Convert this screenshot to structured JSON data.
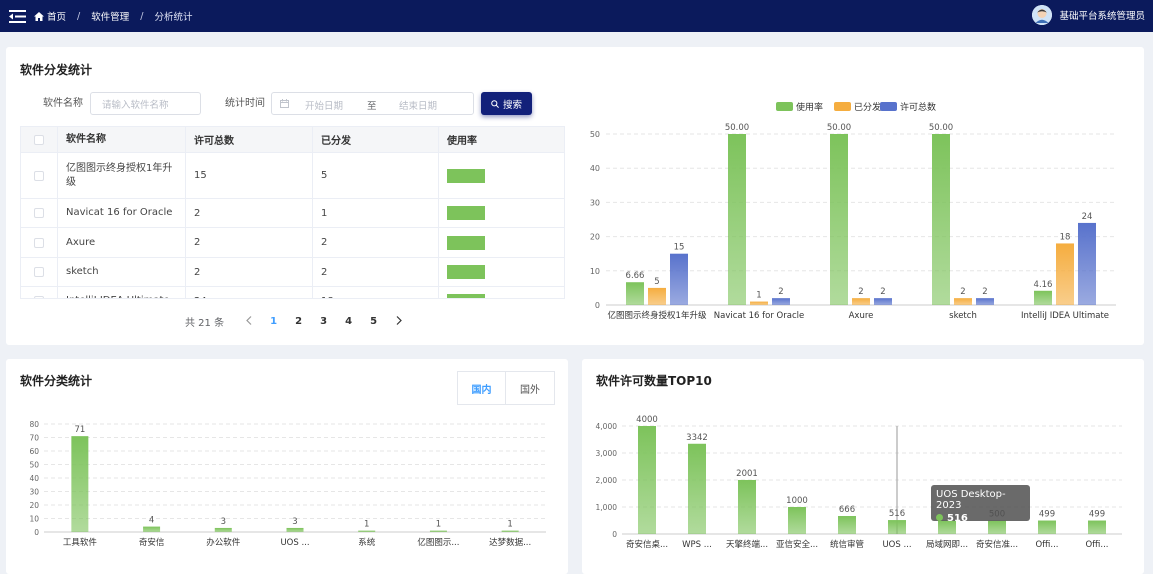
{
  "topbar": {
    "breadcrumbs": [
      "首页",
      "软件管理",
      "分析统计"
    ],
    "separator": "/",
    "user_name": "基础平台系统管理员"
  },
  "dist": {
    "title": "软件分发统计",
    "filters": {
      "name_label": "软件名称",
      "name_placeholder": "请输入软件名称",
      "time_label": "统计时间",
      "start_placeholder": "开始日期",
      "range_sep": "至",
      "end_placeholder": "结束日期",
      "search_label": "搜索"
    },
    "table": {
      "headers": [
        "软件名称",
        "许可总数",
        "已分发",
        "使用率"
      ],
      "rows": [
        {
          "name": "亿图图示终身授权1年升级",
          "total": "15",
          "dist": "5",
          "rate": 0.3333
        },
        {
          "name": "Navicat 16 for Oracle",
          "total": "2",
          "dist": "1",
          "rate": 0.5
        },
        {
          "name": "Axure",
          "total": "2",
          "dist": "2",
          "rate": 1
        },
        {
          "name": "sketch",
          "total": "2",
          "dist": "2",
          "rate": 1
        },
        {
          "name": "IntelliJ IDEA Ultimate",
          "total": "24",
          "dist": "18",
          "rate": 0.75
        }
      ]
    },
    "pagination": {
      "total": "共 21 条",
      "pages": [
        "1",
        "2",
        "3",
        "4",
        "5"
      ],
      "current": "1"
    }
  },
  "chart_data": [
    {
      "type": "bar",
      "legend": [
        "使用率",
        "已分发",
        "许可总数"
      ],
      "legend_position": "top",
      "categories": [
        "亿图图示终身授权1年升级",
        "Navicat 16 for Oracle",
        "Axure",
        "sketch",
        "IntelliJ IDEA Ultimate"
      ],
      "series": [
        {
          "name": "使用率",
          "values": [
            6.66,
            50.0,
            50.0,
            50.0,
            4.16
          ],
          "labels": [
            "6.66",
            "50.00",
            "50.00",
            "50.00",
            "4.16"
          ],
          "color": "#7dc35b"
        },
        {
          "name": "已分发",
          "values": [
            5,
            1,
            2,
            2,
            18
          ],
          "labels": [
            "5",
            "1",
            "2",
            "2",
            "18"
          ],
          "color": "#f5ad3f"
        },
        {
          "name": "许可总数",
          "values": [
            15,
            2,
            2,
            2,
            24
          ],
          "labels": [
            "15",
            "2",
            "2",
            "2",
            "24"
          ],
          "color": "#5872cc"
        }
      ],
      "ylim": [
        0,
        50
      ],
      "yticks": [
        "0",
        "10",
        "20",
        "30",
        "40",
        "50"
      ],
      "grid": true
    },
    {
      "type": "bar",
      "title": "软件分类统计",
      "categories": [
        "工具软件",
        "奇安信",
        "办公软件",
        "UOS ...",
        "系统",
        "亿图图示...",
        "达梦数据..."
      ],
      "values": [
        71,
        4,
        3,
        3,
        1,
        1,
        1
      ],
      "labels": [
        "71",
        "4",
        "3",
        "3",
        "1",
        "1",
        "1"
      ],
      "ylim": [
        0,
        80
      ],
      "yticks": [
        "0",
        "10",
        "20",
        "30",
        "40",
        "50",
        "60",
        "70",
        "80"
      ],
      "color": "#7dc35b",
      "grid": true
    },
    {
      "type": "bar",
      "title": "软件许可数量TOP10",
      "categories": [
        "奇安信桌...",
        "WPS ...",
        "天擎终端...",
        "亚信安全...",
        "统信审管",
        "UOS ...",
        "局域网即...",
        "奇安信准...",
        "Offi...",
        "Offi..."
      ],
      "values": [
        4000,
        3342,
        2001,
        1000,
        666,
        516,
        500,
        500,
        499,
        499
      ],
      "labels": [
        "4000",
        "3342",
        "2001",
        "1000",
        "666",
        "516",
        "",
        "500",
        "499",
        "499"
      ],
      "ylim": [
        0,
        4000
      ],
      "yticks": [
        "0",
        "1,000",
        "2,000",
        "3,000",
        "4,000"
      ],
      "color": "#7dc35b",
      "grid": true,
      "tooltip": {
        "name": "UOS Desktop-2023",
        "value": "516"
      }
    }
  ],
  "category": {
    "title": "软件分类统计",
    "tabs": [
      "国内",
      "国外"
    ],
    "active_tab": "国内"
  },
  "top10": {
    "title": "软件许可数量TOP10"
  },
  "colors": {
    "topbar": "#0b1a5c",
    "button": "#12207a",
    "green": "#7dc35b",
    "orange": "#f5ad3f",
    "blue": "#5872cc",
    "link": "#409eff"
  },
  "icons": [
    "menu-icon",
    "home-icon",
    "calendar-icon",
    "search-icon",
    "avatar-icon",
    "chevron-left-icon",
    "chevron-right-icon"
  ]
}
